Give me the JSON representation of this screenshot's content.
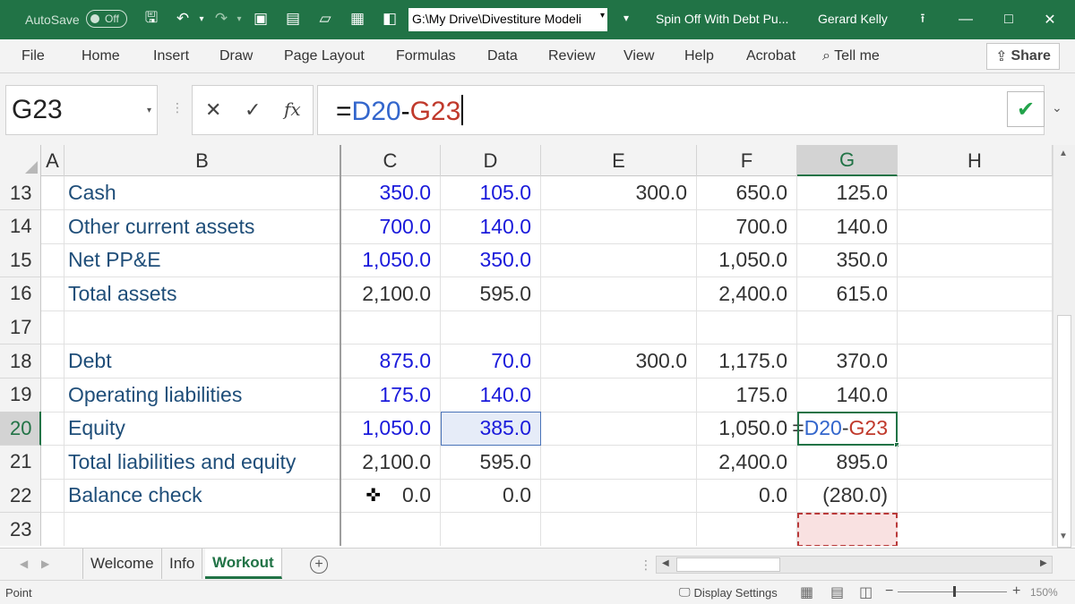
{
  "titlebar": {
    "autosave_label": "AutoSave",
    "autosave_state": "Off",
    "path": "G:\\My Drive\\Divestiture Modeli",
    "filename": "Spin Off With Debt Pu...",
    "user": "Gerard Kelly"
  },
  "ribbon": {
    "tabs": [
      "File",
      "Home",
      "Insert",
      "Draw",
      "Page Layout",
      "Formulas",
      "Data",
      "Review",
      "View",
      "Help",
      "Acrobat"
    ],
    "tell_me": "Tell me",
    "share": "Share"
  },
  "formula_bar": {
    "name_box": "G23",
    "fx": "fx",
    "formula_prefix": "=",
    "ref1": "D20",
    "operator": "-",
    "ref2": "G23"
  },
  "columns": [
    "A",
    "B",
    "C",
    "D",
    "E",
    "F",
    "G",
    "H"
  ],
  "active_column": "G",
  "rows": [
    {
      "num": "13",
      "label": "Cash",
      "c": "350.0",
      "d": "105.0",
      "e": "300.0",
      "f": "650.0",
      "g": "125.0"
    },
    {
      "num": "14",
      "label": "Other current assets",
      "c": "700.0",
      "d": "140.0",
      "e": "",
      "f": "700.0",
      "g": "140.0"
    },
    {
      "num": "15",
      "label": "Net PP&E",
      "c": "1,050.0",
      "d": "350.0",
      "e": "",
      "f": "1,050.0",
      "g": "350.0"
    },
    {
      "num": "16",
      "label": "Total assets",
      "c": "2,100.0",
      "d": "595.0",
      "e": "",
      "f": "2,400.0",
      "g": "615.0"
    },
    {
      "num": "17",
      "label": "",
      "c": "",
      "d": "",
      "e": "",
      "f": "",
      "g": ""
    },
    {
      "num": "18",
      "label": "Debt",
      "c": "875.0",
      "d": "70.0",
      "e": "300.0",
      "f": "1,175.0",
      "g": "370.0"
    },
    {
      "num": "19",
      "label": "Operating liabilities",
      "c": "175.0",
      "d": "140.0",
      "e": "",
      "f": "175.0",
      "g": "140.0"
    },
    {
      "num": "20",
      "label": "Equity",
      "c": "1,050.0",
      "d": "385.0",
      "e": "",
      "f": "1,050.0",
      "g": "=D20-G23"
    },
    {
      "num": "21",
      "label": "Total liabilities and equity",
      "c": "2,100.0",
      "d": "595.0",
      "e": "",
      "f": "2,400.0",
      "g": "895.0"
    },
    {
      "num": "22",
      "label": "Balance check",
      "c": "0.0",
      "d": "0.0",
      "e": "",
      "f": "0.0",
      "g": "(280.0)"
    },
    {
      "num": "23",
      "label": "",
      "c": "",
      "d": "",
      "e": "",
      "f": "",
      "g": ""
    }
  ],
  "sheets": [
    "Welcome",
    "Info",
    "Workout"
  ],
  "active_sheet": "Workout",
  "status": {
    "mode": "Point",
    "display_settings": "Display Settings",
    "zoom": "150%"
  },
  "colors": {
    "excel_green": "#217346",
    "input_blue": "#1a1adb",
    "label_navy": "#1f4e79",
    "ref_blue": "#3366cc",
    "ref_red": "#c0392b"
  }
}
